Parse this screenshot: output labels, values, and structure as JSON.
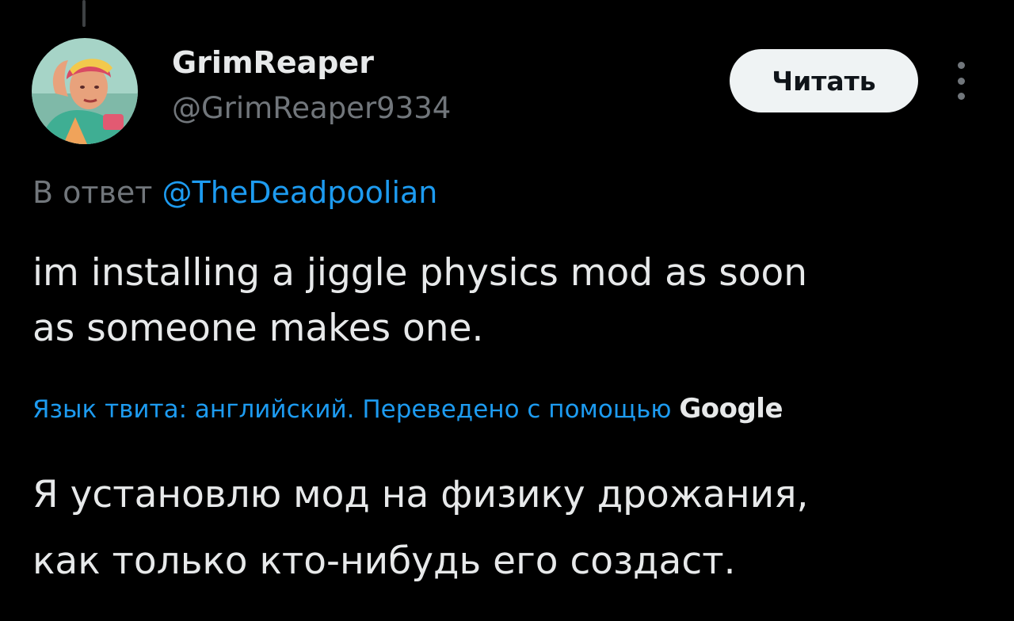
{
  "user": {
    "display_name": "GrimReaper",
    "handle": "@GrimReaper9334",
    "avatar_icon": "avatar-illustration"
  },
  "follow_button": {
    "label": "Читать"
  },
  "more_menu": {
    "icon": "vertical-ellipsis-icon"
  },
  "reply": {
    "prefix": "В ответ",
    "mention": "@TheDeadpoolian"
  },
  "tweet": {
    "lines": [
      "im installing a jiggle physics mod as soon",
      "as someone makes one."
    ]
  },
  "translation": {
    "note": "Язык твита: английский. Переведено с помощью",
    "provider": "Google",
    "lines": [
      "Я установлю мод на физику дрожания,",
      "как только кто-нибудь его создаст."
    ]
  },
  "colors": {
    "background": "#000000",
    "primary_text": "#e7e9ea",
    "secondary_text": "#71767b",
    "accent": "#1d9bf0",
    "button_bg": "#eff3f4"
  }
}
